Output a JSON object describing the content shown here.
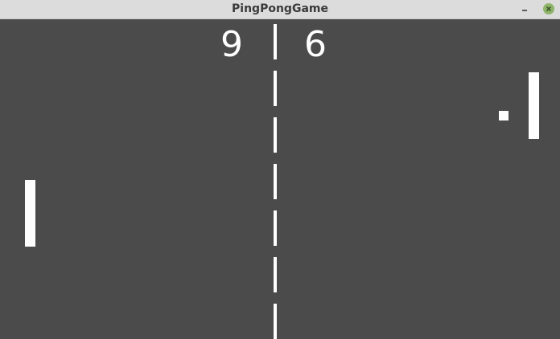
{
  "window": {
    "title": "PingPongGame"
  },
  "titlebar_icons": {
    "minimize": "minimize-icon",
    "close": "close-icon"
  },
  "game": {
    "score_left": "9",
    "score_right": "6"
  },
  "colors": {
    "background": "#4b4b4b",
    "foreground": "#ffffff",
    "titlebar": "#dcdcdc",
    "close_button": "#8fb46a"
  }
}
